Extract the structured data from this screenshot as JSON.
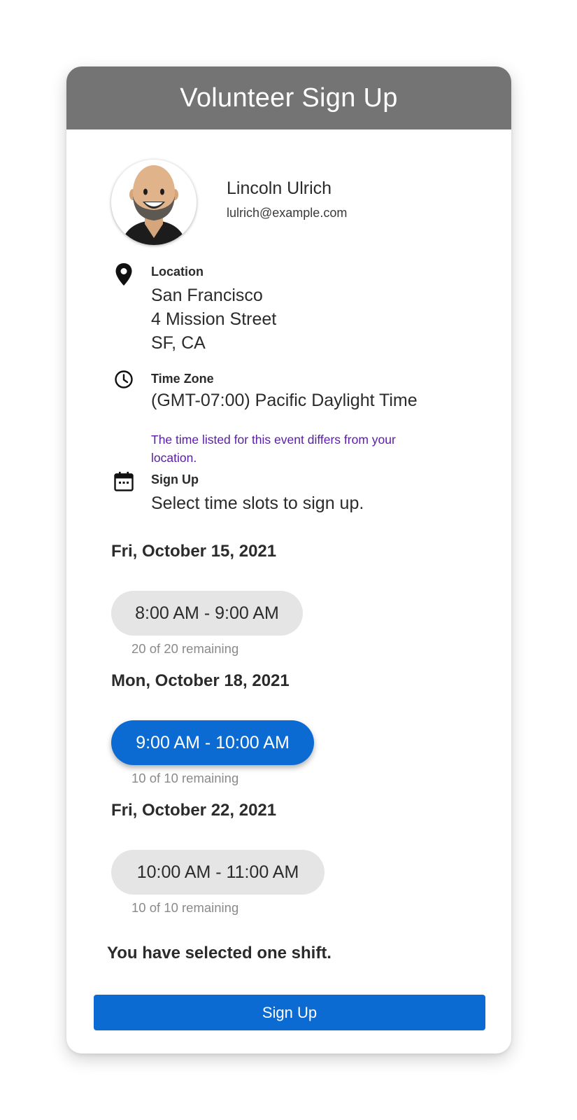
{
  "header": {
    "title": "Volunteer Sign Up"
  },
  "user": {
    "name": "Lincoln Ulrich",
    "email": "lulrich@example.com",
    "avatar_icon": "person-avatar-icon"
  },
  "location": {
    "icon": "location-pin-icon",
    "label": "Location",
    "lines": [
      "San Francisco",
      "4 Mission Street",
      "SF, CA"
    ]
  },
  "time_zone": {
    "icon": "clock-icon",
    "label": "Time Zone",
    "value": "(GMT-07:00) Pacific Daylight Time",
    "notice": "The time listed for this event differs from your location."
  },
  "sign_up_info": {
    "icon": "calendar-icon",
    "label": "Sign Up",
    "value": "Select time slots to sign up."
  },
  "shifts": [
    {
      "date": "Fri, October 15, 2021",
      "time": "8:00 AM - 9:00 AM",
      "remaining": "20 of 20 remaining",
      "selected": false
    },
    {
      "date": "Mon, October 18, 2021",
      "time": "9:00 AM - 10:00 AM",
      "remaining": "10 of 10 remaining",
      "selected": true
    },
    {
      "date": "Fri, October 22, 2021",
      "time": "10:00 AM - 11:00 AM",
      "remaining": "10 of 10 remaining",
      "selected": false
    }
  ],
  "selection_message": "You have selected one shift.",
  "submit_label": "Sign Up",
  "colors": {
    "header_bg": "#747474",
    "accent": "#0b6bd3",
    "notice": "#5a1ba9",
    "slot_bg": "#e5e5e5"
  }
}
